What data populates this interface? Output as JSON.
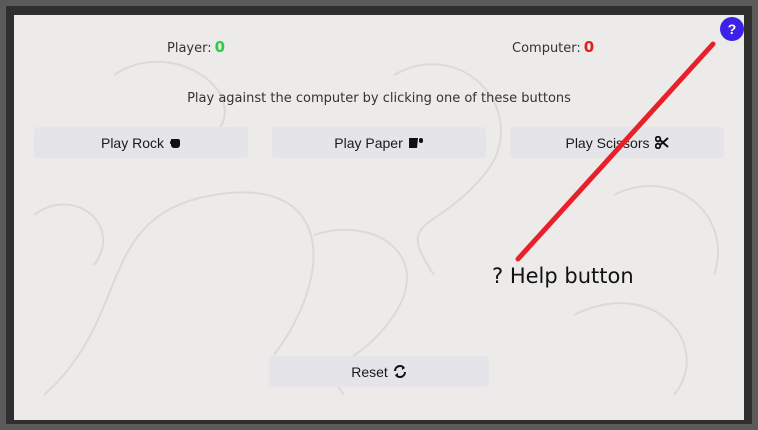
{
  "scoreboard": {
    "player_label": "Player:",
    "player_score": "0",
    "computer_label": "Computer:",
    "computer_score": "0",
    "player_color": "#2ecc40",
    "computer_color": "#e02020"
  },
  "instructions": "Play against the computer by clicking one of these buttons",
  "buttons": {
    "rock": {
      "label": "Play Rock",
      "icon": "fist-icon"
    },
    "paper": {
      "label": "Play Paper",
      "icon": "hand-paper-icon"
    },
    "scissors": {
      "label": "Play Scissors",
      "icon": "scissors-icon"
    },
    "reset": {
      "label": "Reset",
      "icon": "refresh-icon"
    }
  },
  "help": {
    "label": "?",
    "color": "#3c22e8"
  },
  "annotation": {
    "text": "? Help button",
    "arrow_color": "#e8202a"
  }
}
